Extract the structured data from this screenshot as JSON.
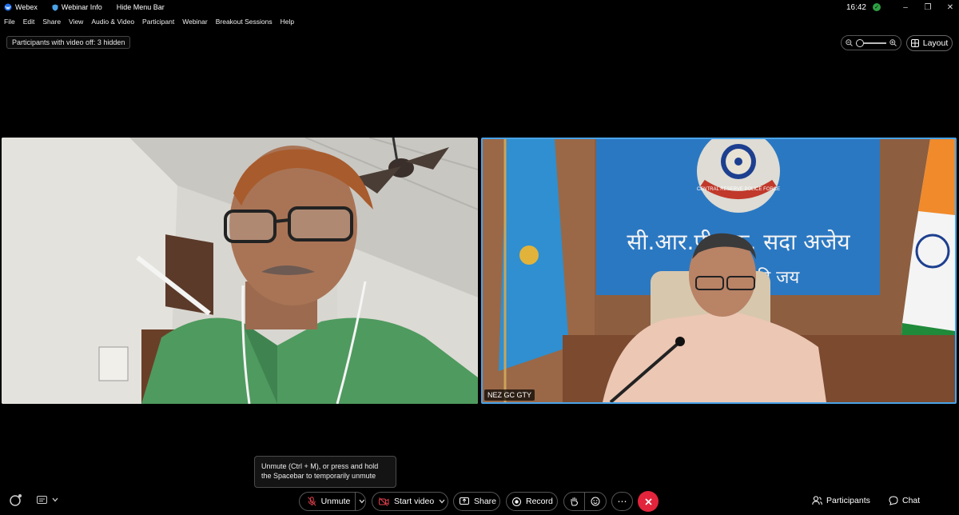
{
  "titlebar": {
    "app_name": "Webex",
    "webinar_info": "Webinar Info",
    "hide_menu": "Hide Menu Bar",
    "time": "16:42"
  },
  "menu": [
    "File",
    "Edit",
    "Share",
    "View",
    "Audio & Video",
    "Participant",
    "Webinar",
    "Breakout Sessions",
    "Help"
  ],
  "info_chip": "Participants with video off: 3 hidden",
  "layout_label": "Layout",
  "tiles": [
    {
      "name": ""
    },
    {
      "name": "NEZ GC GTY",
      "backdrop_line1": "सी.आर.पी.एफ. सदा अजेय",
      "backdrop_line2": "भारत माता की जय",
      "emblem_text": "CENTRAL RESERVE POLICE FORCE"
    }
  ],
  "tooltip": "Unmute (Ctrl + M), or press and hold the Spacebar to temporarily unmute",
  "controls": {
    "unmute": "Unmute",
    "start_video": "Start video",
    "share": "Share",
    "record": "Record"
  },
  "right_controls": {
    "participants": "Participants",
    "chat": "Chat"
  },
  "colors": {
    "leave": "#e2253c",
    "active_speaker_border": "#4aa3e8",
    "status": "#2ea043"
  }
}
